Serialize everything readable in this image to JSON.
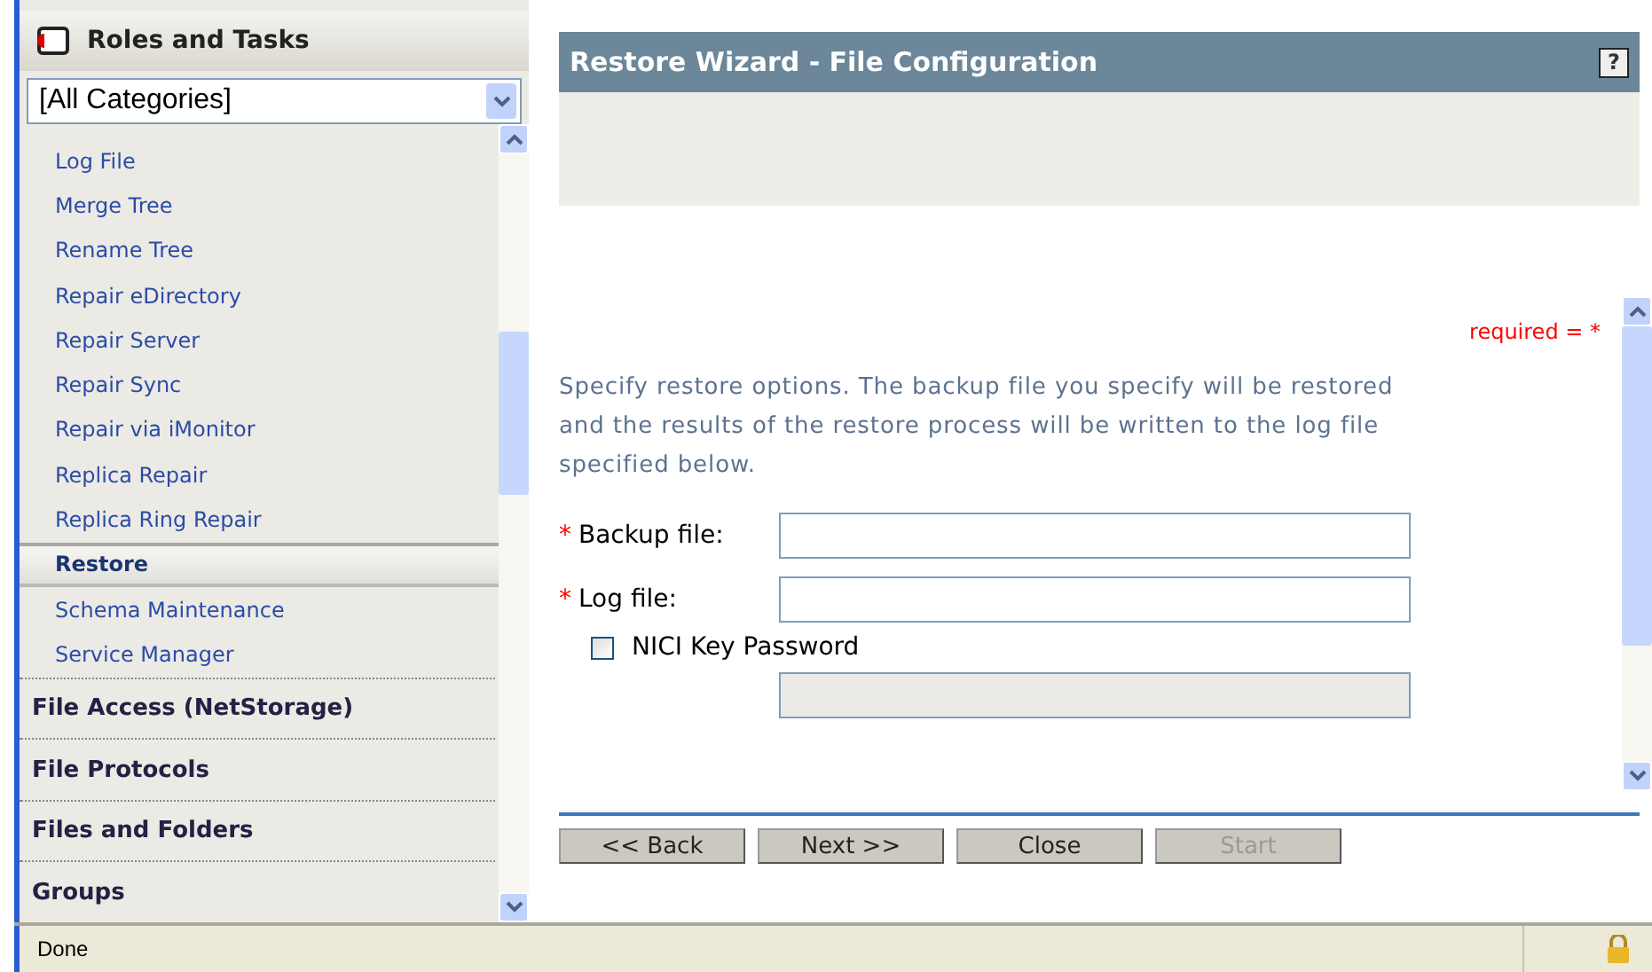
{
  "sidebar": {
    "title": "Roles and Tasks",
    "category_select": {
      "value": "[All Categories]"
    },
    "items": [
      {
        "kind": "task",
        "label": "Log File",
        "selected": false
      },
      {
        "kind": "task",
        "label": "Merge Tree",
        "selected": false
      },
      {
        "kind": "task",
        "label": "Rename Tree",
        "selected": false
      },
      {
        "kind": "task",
        "label": "Repair eDirectory",
        "selected": false
      },
      {
        "kind": "task",
        "label": "Repair Server",
        "selected": false
      },
      {
        "kind": "task",
        "label": "Repair Sync",
        "selected": false
      },
      {
        "kind": "task",
        "label": "Repair via iMonitor",
        "selected": false
      },
      {
        "kind": "task",
        "label": "Replica Repair",
        "selected": false
      },
      {
        "kind": "task",
        "label": "Replica Ring Repair",
        "selected": false
      },
      {
        "kind": "task",
        "label": "Restore",
        "selected": true
      },
      {
        "kind": "task",
        "label": "Schema Maintenance",
        "selected": false
      },
      {
        "kind": "task",
        "label": "Service Manager",
        "selected": false
      },
      {
        "kind": "category",
        "label": "File Access (NetStorage)"
      },
      {
        "kind": "category",
        "label": "File Protocols"
      },
      {
        "kind": "category",
        "label": "Files and Folders"
      },
      {
        "kind": "category",
        "label": "Groups"
      }
    ]
  },
  "wizard": {
    "title": "Restore Wizard - File Configuration",
    "help": "?",
    "required_note": "required = *",
    "description": "Specify restore options. The backup file you specify will be restored and the results of the restore process will be written to the log file specified below.",
    "fields": [
      {
        "kind": "text",
        "required_mark": "*",
        "label": "Backup file:",
        "disabled": false
      },
      {
        "kind": "text",
        "required_mark": "*",
        "label": "Log file:",
        "disabled": false
      },
      {
        "kind": "checkbox",
        "label": "NICI Key Password",
        "checked": false
      },
      {
        "kind": "text",
        "disabled": true
      }
    ],
    "buttons": [
      {
        "label": "<< Back",
        "disabled": false
      },
      {
        "label": "Next >>",
        "disabled": false
      },
      {
        "label": "Close",
        "disabled": false
      },
      {
        "label": "Start",
        "disabled": true
      }
    ]
  },
  "status_bar": {
    "text": "Done"
  }
}
